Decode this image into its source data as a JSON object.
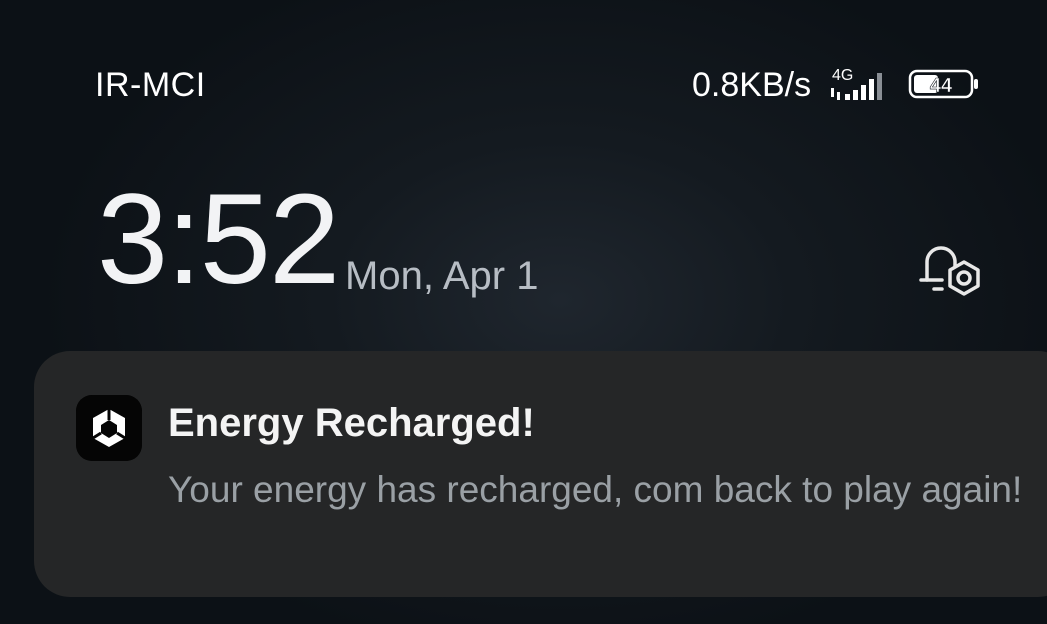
{
  "status_bar": {
    "carrier": "IR-MCI",
    "network_speed": "0.8KB/s",
    "network_type": "4G",
    "signal_icon": "cellular-signal-icon",
    "battery_level": "44",
    "battery_icon": "battery-icon"
  },
  "lock_screen": {
    "time": "3:52",
    "date": "Mon, Apr 1",
    "settings_icon": "notification-settings-icon"
  },
  "notification": {
    "app_icon": "unity-icon",
    "title": "Energy Recharged!",
    "body": "Your energy has recharged, com back to play again!"
  }
}
